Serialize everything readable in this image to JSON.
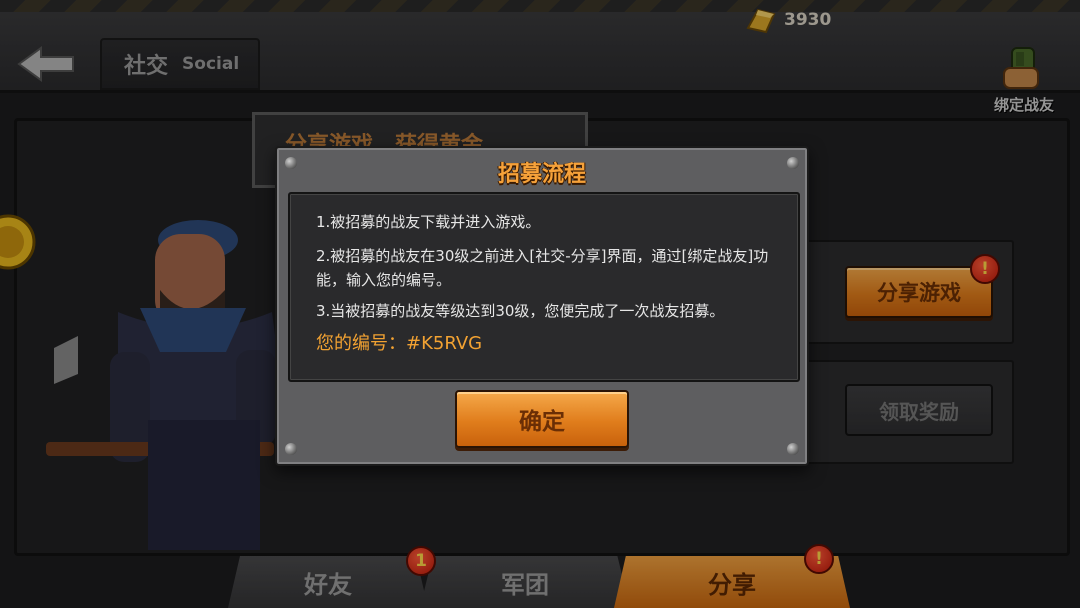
{
  "header": {
    "title_cn": "社交",
    "title_en": "Social",
    "gold": "3930",
    "bind_label": "绑定战友"
  },
  "background_panel": {
    "bubble_text": "分享游戏，获得黄金",
    "share_game_label": "分享游戏",
    "claim_reward_label": "领取奖励"
  },
  "tabs": [
    {
      "label": "好友",
      "badge": "1",
      "active": false
    },
    {
      "label": "军团",
      "active": false
    },
    {
      "label": "分享",
      "badge": "!",
      "active": true
    }
  ],
  "modal": {
    "title": "招募流程",
    "lines": [
      "1.被招募的战友下载并进入游戏。",
      "2.被招募的战友在30级之前进入[社交-分享]界面，通过[绑定战友]功能，输入您的编号。",
      "3.当被招募的战友等级达到30级，您便完成了一次战友招募。"
    ],
    "code_label": "您的编号：#K5RVG",
    "confirm_label": "确定"
  },
  "colors": {
    "accent_orange": "#e07d1c",
    "code_text": "#f2a232",
    "badge_red": "#c21a0a"
  }
}
